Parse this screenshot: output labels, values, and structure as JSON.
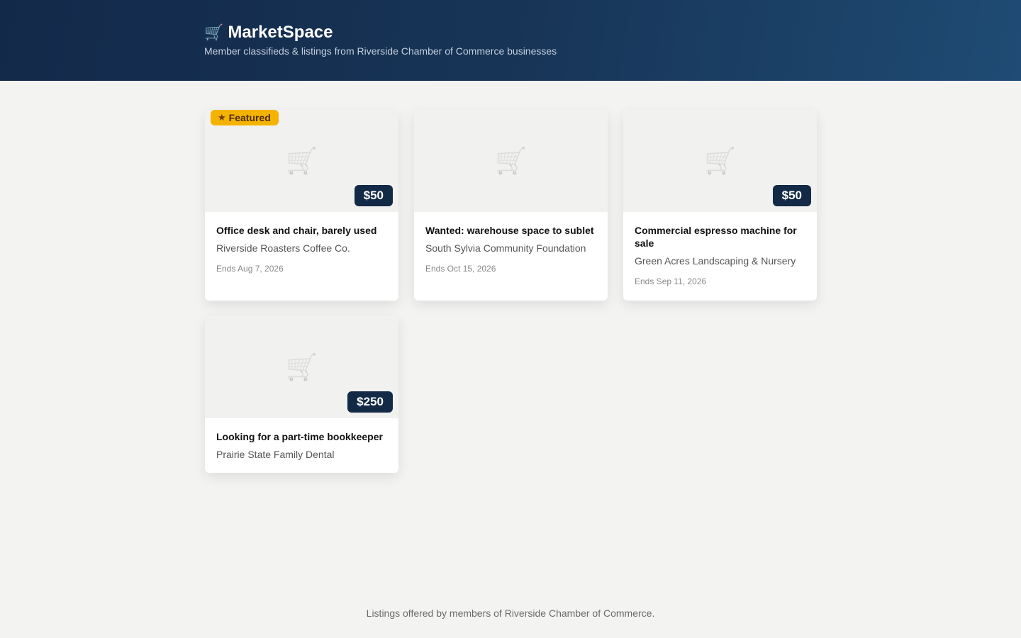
{
  "header": {
    "icon": "shopping-cart-icon",
    "title": "MarketSpace",
    "subtitle": "Member classifieds & listings from Riverside Chamber of Commerce businesses"
  },
  "listings": [
    {
      "featured": true,
      "featured_label": "Featured",
      "price": "$50",
      "title": "Office desk and chair, barely used",
      "seller": "Riverside Roasters Coffee Co.",
      "ends": "Ends Aug 7, 2026"
    },
    {
      "featured": false,
      "price": "",
      "title": "Wanted: warehouse space to sublet",
      "seller": "South Sylvia Community Foundation",
      "ends": "Ends Oct 15, 2026"
    },
    {
      "featured": false,
      "price": "$50",
      "title": "Commercial espresso machine for sale",
      "seller": "Green Acres Landscaping & Nursery",
      "ends": "Ends Sep 11, 2026"
    },
    {
      "featured": false,
      "price": "$250",
      "title": "Looking for a part-time bookkeeper",
      "seller": "Prairie State Family Dental",
      "ends": ""
    }
  ],
  "footer": {
    "text": "Listings offered by members of Riverside Chamber of Commerce."
  },
  "colors": {
    "header_bg": "#173456",
    "featured_badge": "#f5b301",
    "price_badge": "#132a47",
    "page_bg": "#f3f3f2"
  }
}
